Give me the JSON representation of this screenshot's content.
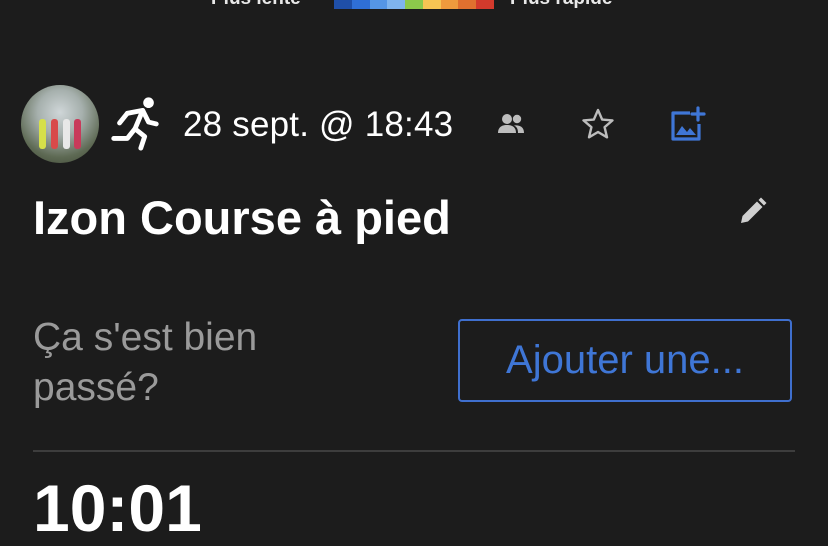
{
  "pace_legend": {
    "slow_label": "Plus lente",
    "fast_label": "Plus rapide",
    "colors": [
      "#1f4fa8",
      "#2f6fd6",
      "#5596e6",
      "#7fb4ee",
      "#8cc84b",
      "#f6c453",
      "#ef9a3d",
      "#e0702f",
      "#d33a2c"
    ]
  },
  "activity": {
    "type_icon": "running-icon",
    "date": "28 sept. @ 18:43",
    "title": "Izon Course à pied",
    "prompt": "Ça s'est bien passé?",
    "add_button_label": "Ajouter une...",
    "stat_partial": "10:01"
  },
  "toolbar": {
    "icons": [
      "people-icon",
      "star-icon",
      "add-photo-icon",
      "edit-icon"
    ]
  },
  "colors": {
    "background": "#1c1c1c",
    "accent": "#3f76d6",
    "muted_text": "#9a9a9a"
  }
}
